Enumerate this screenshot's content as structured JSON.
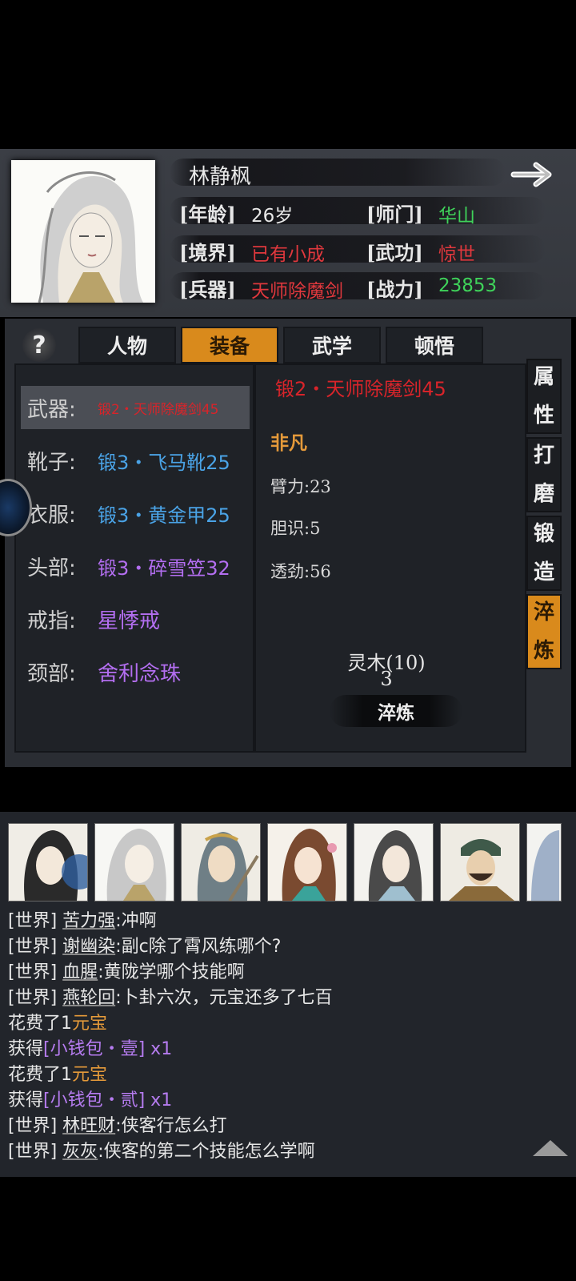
{
  "character": {
    "name": "林静枫",
    "age_label": "[年龄]",
    "age": "26岁",
    "sect_label": "[师门]",
    "sect": "华山",
    "realm_label": "[境界]",
    "realm": "已有小成",
    "martial_label": "[武功]",
    "martial": "惊世",
    "weapon_label": "[兵器]",
    "weapon": "天师除魔剑",
    "power_label": "[战力]",
    "power": "23853"
  },
  "tabs": [
    "人物",
    "装备",
    "武学",
    "顿悟"
  ],
  "active_tab": "装备",
  "help_label": "?",
  "equipment": [
    {
      "slot": "武器:",
      "item": "锻2・天师除魔剑45",
      "color": "#d8242a"
    },
    {
      "slot": "靴子:",
      "item": "锻3・飞马靴25",
      "color": "#4aa3e6"
    },
    {
      "slot": "衣服:",
      "item": "锻3・黄金甲25",
      "color": "#4aa3e6"
    },
    {
      "slot": "头部:",
      "item": "锻3・碎雪笠32",
      "color": "#b36ef0"
    },
    {
      "slot": "戒指:",
      "item": "星悸戒",
      "color": "#b36ef0"
    },
    {
      "slot": "颈部:",
      "item": "舍利念珠",
      "color": "#b36ef0"
    }
  ],
  "detail": {
    "title": "锻2・天师除魔剑45",
    "grade": "非凡",
    "stats": [
      "臂力:23",
      "胆识:5",
      "透劲:56"
    ],
    "material": "灵木(10)",
    "material_count": "3",
    "action_label": "淬炼"
  },
  "side_tabs": [
    {
      "chars": [
        "属",
        "性"
      ]
    },
    {
      "chars": [
        "打",
        "磨"
      ]
    },
    {
      "chars": [
        "锻",
        "造"
      ]
    },
    {
      "chars": [
        "淬",
        "炼"
      ]
    }
  ],
  "chat": [
    {
      "tag": "[世界]",
      "name": "苦力强",
      "text": ":冲啊"
    },
    {
      "tag": "[世界]",
      "name": "谢幽染",
      "text": ":副c除了霄风练哪个?"
    },
    {
      "tag": "[世界]",
      "name": "血腥",
      "text": ":黄陇学哪个技能啊"
    },
    {
      "tag": "[世界]",
      "name": "燕轮回",
      "text": ":卜卦六次，元宝还多了七百"
    },
    {
      "pre": "花费了1",
      "hl": "元宝",
      "hl_color": "orange",
      "post": ""
    },
    {
      "pre": "获得",
      "hl": "[小钱包・壹]",
      "hl_color": "purple",
      "post": " x1"
    },
    {
      "pre": "花费了1",
      "hl": "元宝",
      "hl_color": "orange",
      "post": ""
    },
    {
      "pre": "获得",
      "hl": "[小钱包・贰]",
      "hl_color": "purple",
      "post": " x1"
    },
    {
      "tag": "[世界]",
      "name": "林旺财",
      "text": ":侠客行怎么打"
    },
    {
      "tag": "[世界]",
      "name": "灰灰",
      "text": ":侠客的第二个技能怎么学啊"
    }
  ],
  "colors": {
    "accent": "#d98a1c",
    "red": "#e0383d",
    "green": "#3fd35a",
    "orange": "#e59a3a"
  }
}
